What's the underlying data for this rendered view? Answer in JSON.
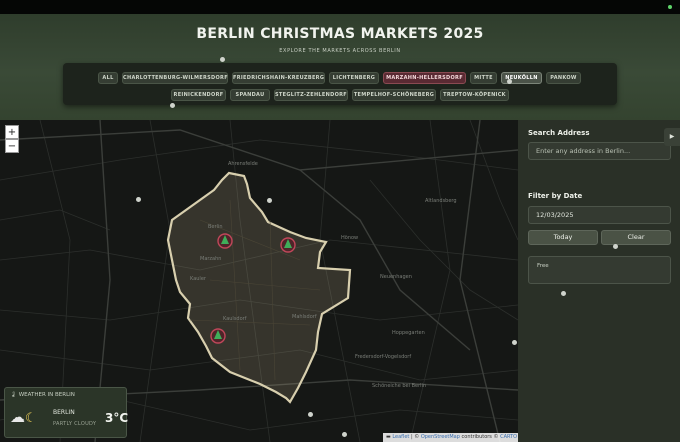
{
  "header": {
    "title": "BERLIN CHRISTMAS MARKETS 2025",
    "subtitle": "EXPLORE THE MARKETS ACROSS BERLIN"
  },
  "districts": {
    "row1": [
      "ALL",
      "CHARLOTTENBURG-WILMERSDORF",
      "FRIEDRICHSHAIN-KREUZBERG",
      "LICHTENBERG",
      "MARZAHN-HELLERSDORF",
      "MITTE",
      "NEUKÖLLN",
      "PANKOW"
    ],
    "row2": [
      "REINICKENDORF",
      "SPANDAU",
      "STEGLITZ-ZEHLENDORF",
      "TEMPELHOF-SCHÖNEBERG",
      "TREPTOW-KÖPENICK"
    ],
    "active": "MARZAHN-HELLERSDORF",
    "hovered": "NEUKÖLLN"
  },
  "map": {
    "zoom_in": "+",
    "zoom_out": "−",
    "place_labels": [
      "Ahrensfelde",
      "Altlandsberg",
      "Hönow",
      "Neuenhagen",
      "Berlin",
      "Hoppegarten",
      "Mahlsdorf",
      "Kaulsdorf",
      "Kauler",
      "Marzahn",
      "Schöneiche bei Berlin",
      "Fredersdorf-Vogelsdorf"
    ],
    "attribution": {
      "leaflet": "Leaflet",
      "sep1": " | © ",
      "osm": "OpenStreetMap",
      "sep2": " contributors © ",
      "carto": "CARTO"
    }
  },
  "weather": {
    "heading": "WEATHER IN BERLIN",
    "heading_icon": "thermometer-icon",
    "icon": "partly-cloudy-night-icon",
    "city": "BERLIN",
    "description": "PARTLY CLOUDY",
    "temperature": "3°C"
  },
  "sidebar": {
    "search_label": "Search Address",
    "search_placeholder": "Enter any address in Berlin...",
    "date_label": "Filter by Date",
    "date_value": "12/03/2025",
    "today_button": "Today",
    "clear_button": "Clear",
    "result_text": "Free",
    "collapse_icon": "play-icon"
  },
  "colors": {
    "header_bg": "#34432f",
    "active_chip": "#5a2a33",
    "district_outline": "#d8cfae",
    "marker": "#c0475a",
    "tree": "#3fae5a"
  }
}
